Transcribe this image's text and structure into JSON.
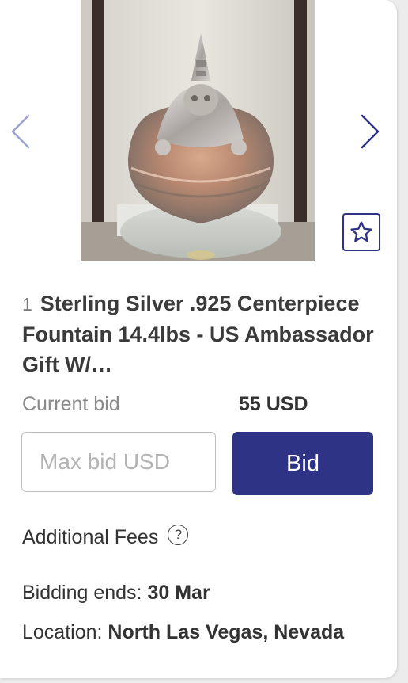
{
  "listing": {
    "lot_number": "1",
    "title": "Sterling Silver .925 Centerpiece Fountain 14.4lbs - US Ambassador Gift W/…",
    "current_bid_label": "Current bid",
    "current_bid_value": "55 USD",
    "max_bid_placeholder": "Max bid USD",
    "bid_button_label": "Bid",
    "additional_fees_label": "Additional Fees",
    "help_glyph": "?",
    "bidding_ends_label": "Bidding ends:",
    "bidding_ends_value": "30 Mar",
    "location_label": "Location:",
    "location_value": "North Las Vegas, Nevada"
  },
  "icons": {
    "prev": "chevron-left-icon",
    "next": "chevron-right-icon",
    "favorite": "star-icon",
    "help": "question-circle-icon"
  },
  "colors": {
    "accent": "#2e3385",
    "nav_arrow_prev": "#9ea1cf",
    "nav_arrow_next": "#2e3385",
    "muted_text": "#8a8a8a",
    "body_text": "#333333"
  }
}
